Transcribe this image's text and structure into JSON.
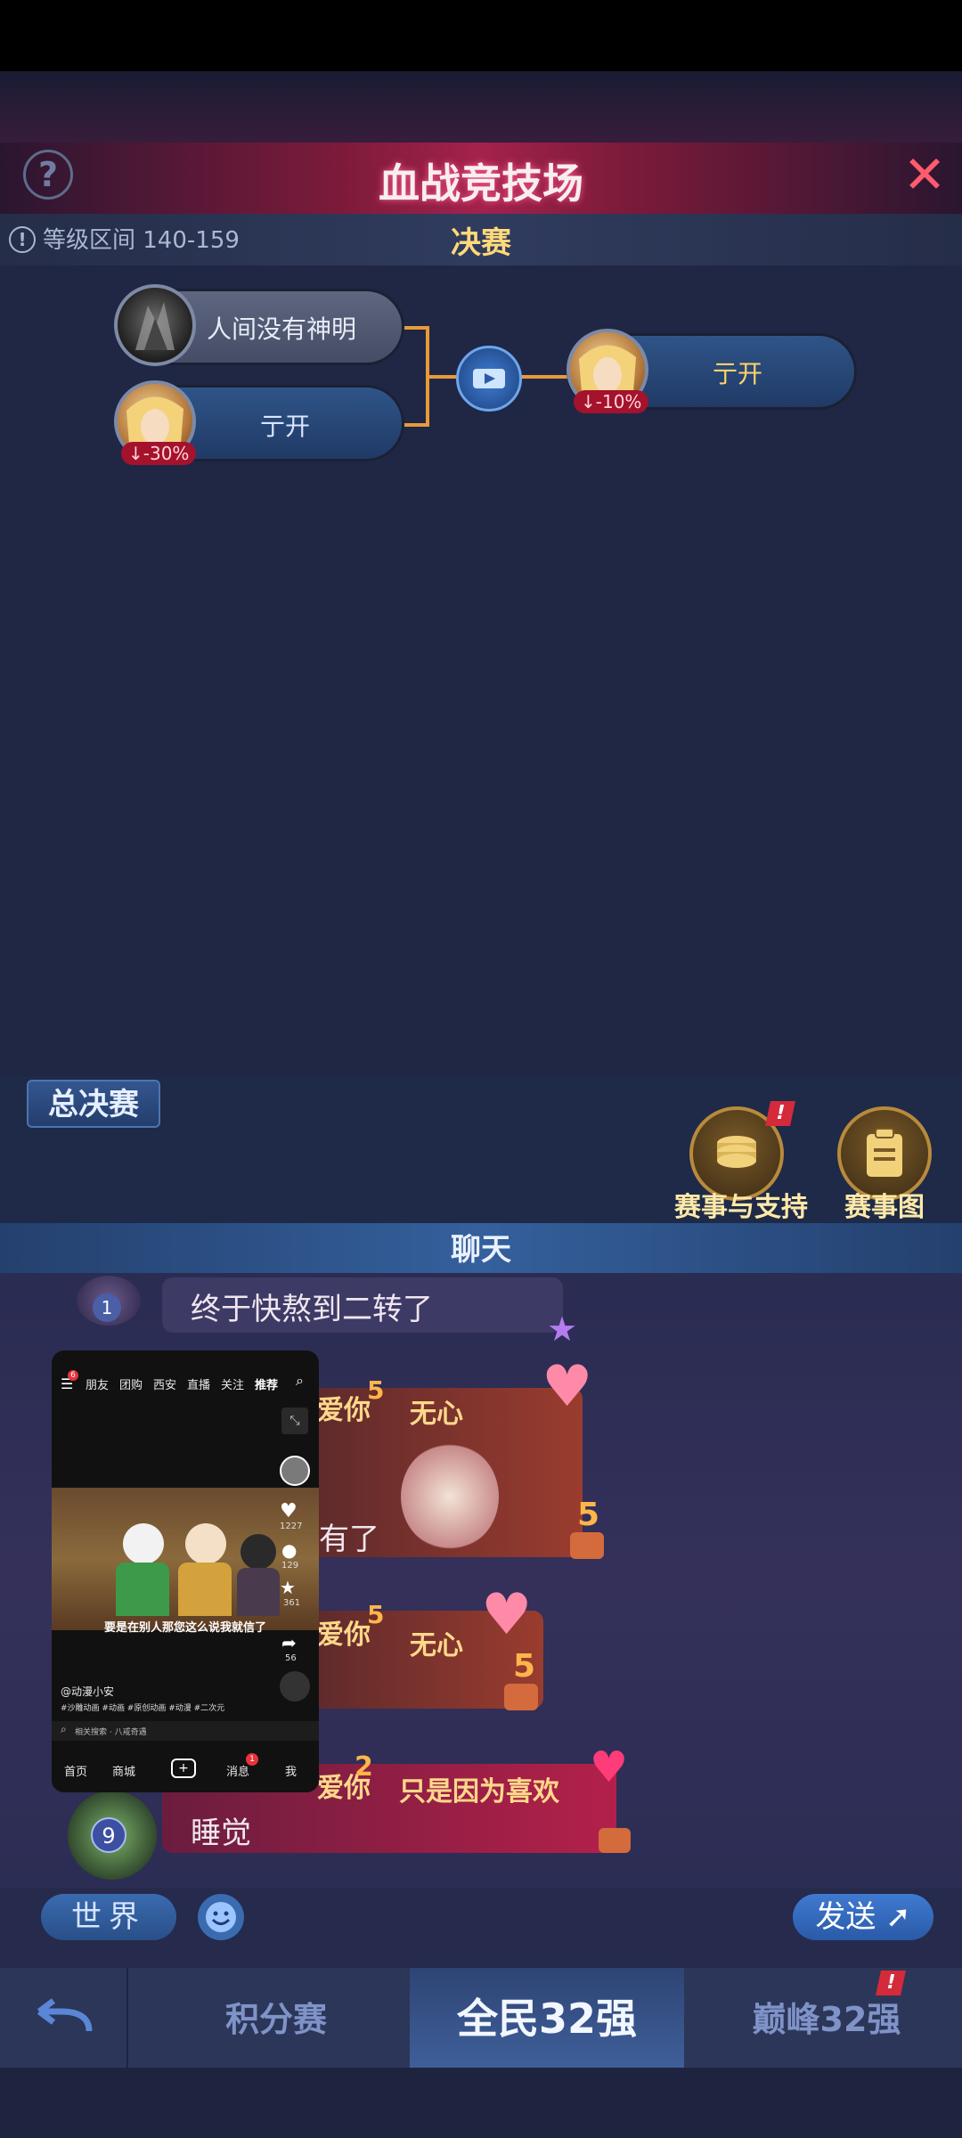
{
  "header": {
    "title": "血战竞技场",
    "help": "?",
    "close": "✕"
  },
  "level_row": {
    "info": "!",
    "range": "等级区间 140-159",
    "round": "决赛"
  },
  "bracket": {
    "semi": [
      {
        "name": "人间没有神明",
        "badge": ""
      },
      {
        "name": "亍开",
        "badge": "-30%"
      }
    ],
    "winner": {
      "name": "亍开",
      "badge": "-10%"
    }
  },
  "final_tab": "总决赛",
  "actions": [
    {
      "label": "赛事与支持",
      "alert": "!"
    },
    {
      "label": "赛事图"
    }
  ],
  "chat": {
    "title": "聊天",
    "messages": [
      {
        "level": "1",
        "text": "终于快熬到二转了"
      },
      {
        "flag": "爱你",
        "title": "无心",
        "text": "有了",
        "num": "5"
      },
      {
        "flag": "爱你",
        "title": "无心",
        "num": "5"
      },
      {
        "flag": "爱你",
        "title": "只是因为喜欢",
        "text": "睡觉",
        "level": "9",
        "num": "2"
      }
    ]
  },
  "pip": {
    "tabs": [
      "朋友",
      "团购",
      "西安",
      "直播",
      "关注",
      "推荐"
    ],
    "notify": "6",
    "caption": "要是在别人那您这么说我就信了",
    "counts": {
      "likes": "1227",
      "comments": "129",
      "favs": "361",
      "shares": "56"
    },
    "author": "@动漫小安",
    "tags": "#沙雕动画 #动画 #原创动画 #动漫 #二次元",
    "search": "相关搜索 · 八戒奇遇",
    "nav": [
      "首页",
      "商城",
      "+",
      "消息",
      "我"
    ],
    "msg_badge": "1"
  },
  "input": {
    "channel": "世界",
    "placeholder": "",
    "send": "发送"
  },
  "bottom_tabs": [
    {
      "label": "积分赛",
      "active": false
    },
    {
      "label": "全民32强",
      "active": true
    },
    {
      "label": "巅峰32强",
      "active": false,
      "alert": "!"
    }
  ]
}
